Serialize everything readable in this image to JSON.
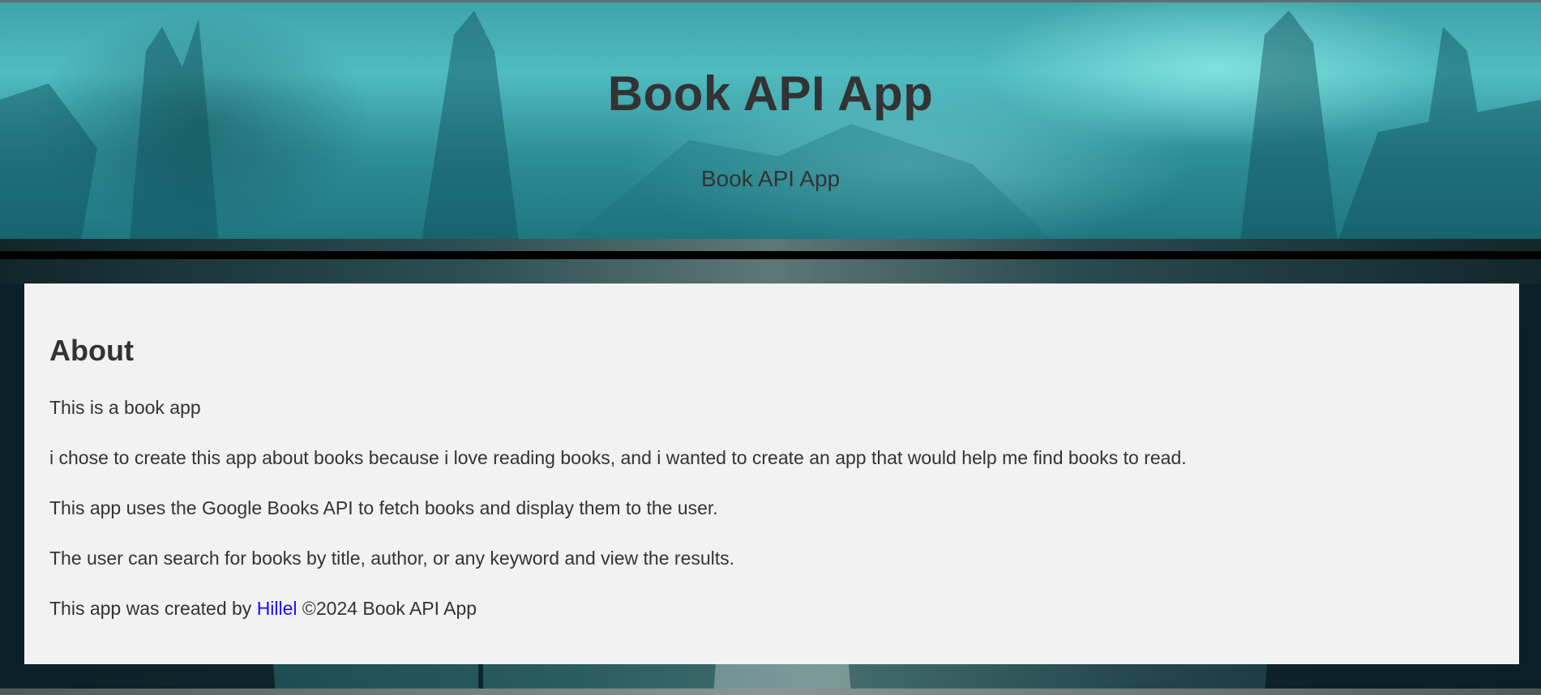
{
  "header": {
    "title": "Book API App",
    "subtitle": "Book API App"
  },
  "about": {
    "heading": "About",
    "paragraphs": [
      "This is a book app",
      "i chose to create this app about books because i love reading books, and i wanted to create an app that would help me find books to read.",
      "This app uses the Google Books API to fetch books and display them to the user.",
      "The user can search for books by title, author, or any keyword and view the results."
    ],
    "credit": {
      "prefix": "This app was created by ",
      "author_link": "Hillel",
      "suffix": " ©2024 Book API App"
    }
  },
  "colors": {
    "text": "#333333",
    "link": "#1a0dff",
    "content_bg": "#f2f2f2",
    "header_teal": "#4fbcc0",
    "divider": "#000000"
  }
}
